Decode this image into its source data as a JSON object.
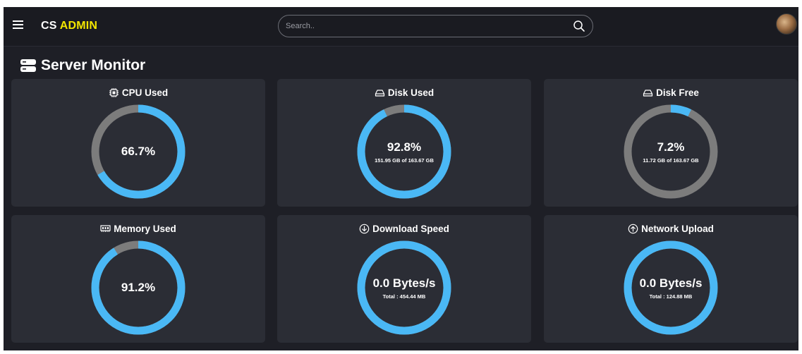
{
  "header": {
    "brand_prefix": "CS",
    "brand_accent": "ADMIN",
    "search_placeholder": "Search.."
  },
  "page": {
    "title": "Server Monitor"
  },
  "colors": {
    "gauge_fill": "#4ab8f5",
    "gauge_track": "#7c7c7c",
    "brand_accent": "#f3e600"
  },
  "cards": [
    {
      "title": "CPU Used",
      "icon": "cpu-icon",
      "value": "66.7%",
      "sub": "",
      "fraction": 0.667
    },
    {
      "title": "Disk Used",
      "icon": "disk-icon",
      "value": "92.8%",
      "sub": "151.95 GB of 163.67 GB",
      "fraction": 0.928
    },
    {
      "title": "Disk Free",
      "icon": "disk-icon",
      "value": "7.2%",
      "sub": "11.72 GB of 163.67 GB",
      "fraction": 0.072
    },
    {
      "title": "Memory Used",
      "icon": "memory-icon",
      "value": "91.2%",
      "sub": "",
      "fraction": 0.912
    },
    {
      "title": "Download Speed",
      "icon": "download-icon",
      "value": "0.0 Bytes/s",
      "sub": "Total : 454.44 MB",
      "fraction": 1.0
    },
    {
      "title": "Network Upload",
      "icon": "upload-icon",
      "value": "0.0 Bytes/s",
      "sub": "Total : 124.88 MB",
      "fraction": 1.0
    }
  ]
}
